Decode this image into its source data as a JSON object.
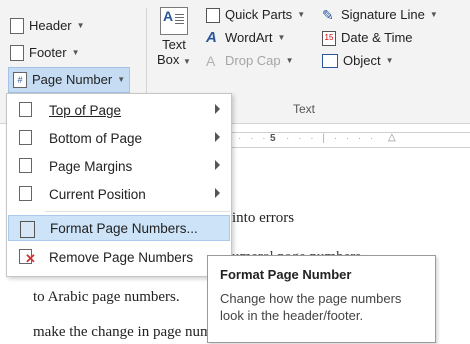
{
  "ribbon": {
    "header_header": {
      "label": "Header"
    },
    "header_footer": {
      "label": "Footer"
    },
    "page_number": {
      "label": "Page Number"
    },
    "text_box": {
      "line1": "Text",
      "line2": "Box"
    },
    "quick_parts": {
      "label": "Quick Parts"
    },
    "wordart": {
      "label": "WordArt"
    },
    "drop_cap": {
      "label": "Drop Cap"
    },
    "signature_line": {
      "label": "Signature Line"
    },
    "date_time": {
      "label": "Date & Time"
    },
    "object": {
      "label": "Object"
    },
    "text_group_label": "Text"
  },
  "ruler": {
    "mark": "5"
  },
  "menu": {
    "items": [
      {
        "label": "Top of Page"
      },
      {
        "label": "Bottom of Page"
      },
      {
        "label": "Page Margins"
      },
      {
        "label": "Current Position"
      },
      {
        "label": "Format Page Numbers..."
      },
      {
        "label": "Remove Page Numbers"
      }
    ]
  },
  "document": {
    "line1": "into errors",
    "line2": "umeral page numbers",
    "line3": "to Arabic page numbers.",
    "line4": "make the change in page numbers, you will want"
  },
  "tooltip": {
    "title": "Format Page Number",
    "body": "Change how the page numbers look in the header/footer."
  },
  "colors": {
    "accent": "#2b579a",
    "highlight": "#cde3f7",
    "remove_x": "#d13438"
  }
}
